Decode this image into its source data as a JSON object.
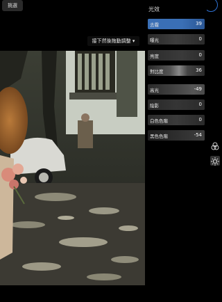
{
  "top_bar": {
    "select_label": "挑選"
  },
  "hint": {
    "text": "接下然後拖動調整 ▾"
  },
  "photo": {
    "description_icon": "photo"
  },
  "panel": {
    "title": "光效",
    "sliders": [
      {
        "label": "去霧",
        "value": "39",
        "active": true
      },
      {
        "label": "曝光",
        "value": "0"
      },
      {
        "label": "亮度",
        "value": "0"
      },
      {
        "label": "對比度",
        "value": "36"
      },
      {
        "label": "高光",
        "value": "-49"
      },
      {
        "label": "陰影",
        "value": "0"
      },
      {
        "label": "白色色階",
        "value": "0"
      },
      {
        "label": "黑色色階",
        "value": "-54"
      }
    ]
  },
  "side_tools": {
    "color_icon": "color-circles-icon",
    "light_icon": "sun-icon"
  },
  "colors": {
    "accent": "#2f72d4",
    "active_row": "#3a6fb5"
  }
}
